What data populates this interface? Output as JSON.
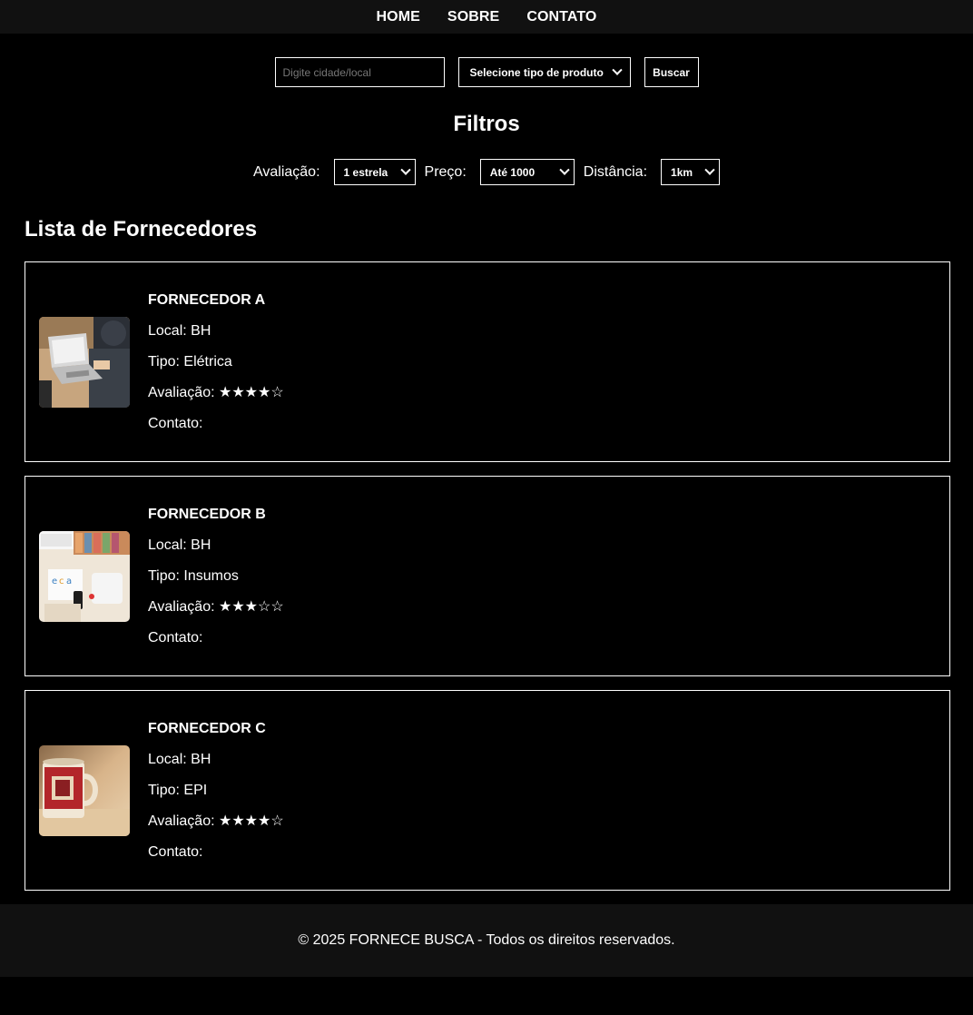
{
  "nav": {
    "items": [
      {
        "label": "HOME"
      },
      {
        "label": "SOBRE"
      },
      {
        "label": "CONTATO"
      }
    ]
  },
  "search": {
    "placeholder": "Digite cidade/local",
    "type_select_value": "Selecione tipo de produto",
    "button_label": "Buscar"
  },
  "filters": {
    "title": "Filtros",
    "rating_label": "Avaliação:",
    "rating_value": "1 estrela",
    "price_label": "Preço:",
    "price_value": "Até 1000",
    "distance_label": "Distância:",
    "distance_value": "1km"
  },
  "list": {
    "title": "Lista de Fornecedores",
    "suppliers": [
      {
        "name": "FORNECEDOR A",
        "local": "Local: BH",
        "tipo": "Tipo: Elétrica",
        "avaliacao": "Avaliação: ★★★★☆",
        "contato": "Contato:",
        "image": "laptop-photo"
      },
      {
        "name": "FORNECEDOR B",
        "local": "Local: BH",
        "tipo": "Tipo: Insumos",
        "avaliacao": "Avaliação: ★★★☆☆",
        "contato": "Contato:",
        "image": "desk-supplies-photo"
      },
      {
        "name": "FORNECEDOR C",
        "local": "Local: BH",
        "tipo": "Tipo: EPI",
        "avaliacao": "Avaliação: ★★★★☆",
        "contato": "Contato:",
        "image": "mug-photo"
      }
    ]
  },
  "footer": {
    "text": "© 2025 FORNECE BUSCA - Todos os direitos reservados."
  }
}
